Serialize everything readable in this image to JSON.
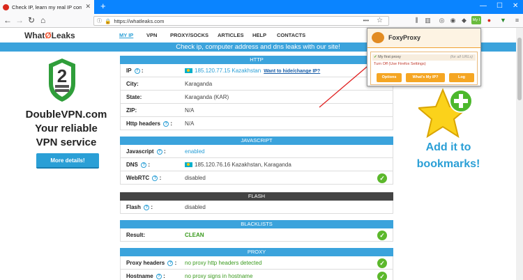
{
  "browser": {
    "tab_title": "Check IP, learn my real IP compu",
    "url": "https://whatleaks.com",
    "new_tab": "+",
    "myip_badge": "My I"
  },
  "site": {
    "logo_text": "What",
    "logo_mid": "Ø",
    "logo_end": "Leaks",
    "nav": [
      "MY IP",
      "VPN",
      "PROXY/SOCKS",
      "ARTICLES",
      "HELP",
      "CONTACTS"
    ],
    "banner": "Check ip, computer address and dns leaks with our site!"
  },
  "ad": {
    "line1": "DoubleVPN.com",
    "line2": "Your reliable",
    "line3": "VPN service",
    "button": "More details!"
  },
  "http": {
    "header": "HTTP",
    "rows": [
      {
        "label": "IP",
        "value": "185.120.77.15 Kazakhstan",
        "link": "Want to hide/change IP?"
      },
      {
        "label": "City:",
        "value": "Karaganda"
      },
      {
        "label": "State:",
        "value": "Karaganda (KAR)"
      },
      {
        "label": "ZIP:",
        "value": "N/A"
      },
      {
        "label": "Http headers",
        "value": "N/A"
      }
    ]
  },
  "javascript": {
    "header": "JAVASCRIPT",
    "rows": [
      {
        "label": "Javascript",
        "value": "enabled"
      },
      {
        "label": "DNS",
        "value": "185.120.76.16 Kazakhstan, Karaganda"
      },
      {
        "label": "WebRTC",
        "value": "disabled"
      }
    ]
  },
  "flash": {
    "header": "FLASH",
    "label": "Flash",
    "value": "disabled"
  },
  "blacklists": {
    "header": "BLACKLISTS",
    "label": "Result:",
    "value": "CLEAN"
  },
  "proxy": {
    "header": "PROXY",
    "rows": [
      {
        "label": "Proxy headers",
        "value": "no proxy http headers detected"
      },
      {
        "label": "Hostname",
        "value": "no proxy signs in hostname"
      }
    ]
  },
  "foxyproxy": {
    "title": "FoxyProxy",
    "option1": "My first proxy",
    "option1_note": "(for all URLs)",
    "option2": "Turn Off (Use Firefox Settings)",
    "buttons": [
      "Options",
      "What's My IP?",
      "Log"
    ]
  },
  "bookmark": {
    "line1": "Add it to",
    "line2": "bookmarks!"
  },
  "colors": {
    "accent": "#3ba3dc",
    "firefox_blue": "#0a84ff",
    "green": "#5cb82c",
    "orange": "#f5a623"
  }
}
